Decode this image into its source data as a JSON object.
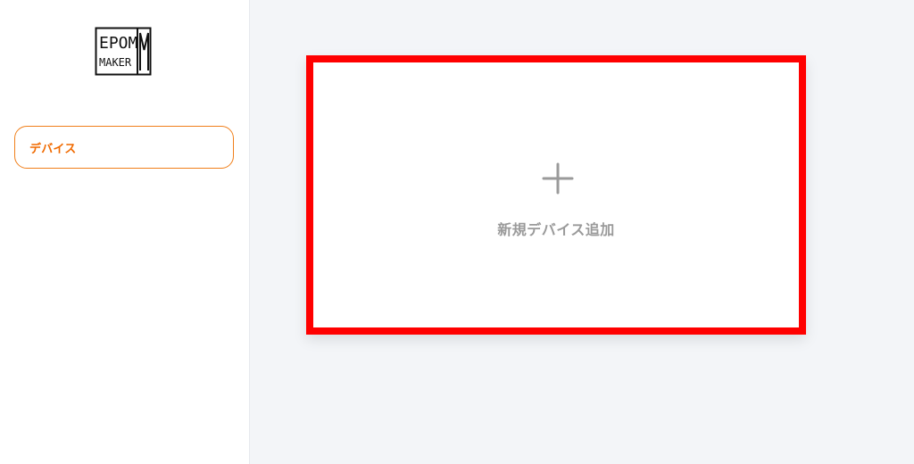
{
  "sidebar": {
    "logo": {
      "line1": "EPOM",
      "line2": "MAKER",
      "icon": "epomaker-logo-icon"
    },
    "items": [
      {
        "label": "デバイス",
        "active": true
      }
    ]
  },
  "main": {
    "add_device": {
      "label": "新規デバイス追加",
      "icon": "plus-icon"
    }
  },
  "colors": {
    "accent": "#f06a00",
    "highlight_border": "#ff0000",
    "muted_text": "#9a9a9a",
    "background": "#f3f5f8"
  }
}
